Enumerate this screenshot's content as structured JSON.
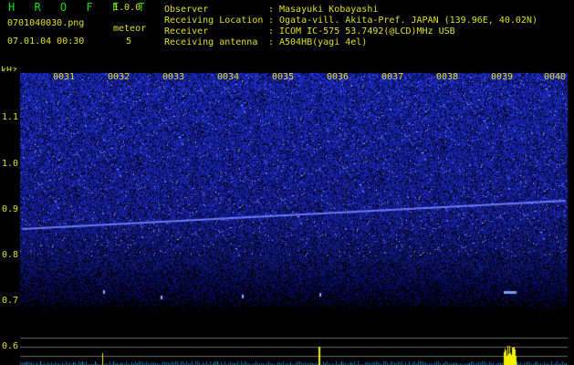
{
  "app": {
    "title": "H R O F F T",
    "version": "1.0.0"
  },
  "file": {
    "name": "0701040030.png",
    "datetime": "07.01.04 00:30"
  },
  "meteor": {
    "label": "meteor",
    "count": "5"
  },
  "station": [
    {
      "label": "Observer",
      "value": "Masayuki Kobayashi"
    },
    {
      "label": "Receiving Location",
      "value": "Ogata-vill. Akita-Pref. JAPAN (139.96E, 40.02N)"
    },
    {
      "label": "Receiver",
      "value": "ICOM IC-575 53.7492(@LCD)MHz USB"
    },
    {
      "label": "Receiving antenna",
      "value": "A504HB(yagi 4el)"
    }
  ],
  "separator": ":",
  "axis": {
    "unit": "kHz",
    "y_ticks": [
      "1.1",
      "1.0",
      "0.9",
      "0.8",
      "0.7",
      "0.6"
    ],
    "minute_labels": [
      "0031",
      "0032",
      "0033",
      "0034",
      "0035",
      "0036",
      "0037",
      "0038",
      "0039",
      "0040"
    ]
  },
  "colors": {
    "header_green": "#10e010",
    "label_yellow": "#e0e020",
    "noise_blue": "#2838d8",
    "carrier": "#6a7aff",
    "echo_yellow": "#f0f000"
  }
}
